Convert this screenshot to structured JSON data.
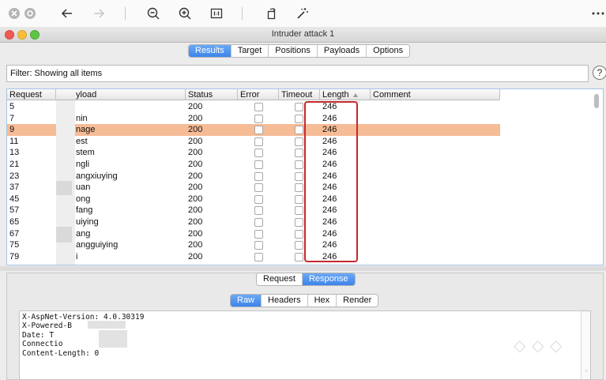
{
  "viewer": {
    "icons": [
      "close-circle-icon",
      "stop-circle-icon",
      "back-arrow-icon",
      "forward-arrow-icon",
      "zoom-out-icon",
      "zoom-in-icon",
      "actual-size-icon",
      "rotate-icon",
      "magic-wand-icon",
      "more-icon"
    ]
  },
  "window": {
    "title": "Intruder attack 1",
    "tabs": [
      {
        "label": "Results",
        "active": true
      },
      {
        "label": "Target",
        "active": false
      },
      {
        "label": "Positions",
        "active": false
      },
      {
        "label": "Payloads",
        "active": false
      },
      {
        "label": "Options",
        "active": false
      }
    ]
  },
  "filter": {
    "text": "Filter: Showing all items",
    "help": "?"
  },
  "table": {
    "columns": [
      "Request",
      "yload",
      "Status",
      "Error",
      "Timeout",
      "Length",
      "Comment"
    ],
    "rows": [
      {
        "request": "5",
        "payload": "",
        "status": "200",
        "length": "246",
        "selected": false
      },
      {
        "request": "7",
        "payload": "nin",
        "status": "200",
        "length": "246",
        "selected": false
      },
      {
        "request": "9",
        "payload": "nage",
        "status": "200",
        "length": "246",
        "selected": true
      },
      {
        "request": "11",
        "payload": "est",
        "status": "200",
        "length": "246",
        "selected": false
      },
      {
        "request": "13",
        "payload": "stem",
        "status": "200",
        "length": "246",
        "selected": false
      },
      {
        "request": "21",
        "payload": "ngli",
        "status": "200",
        "length": "246",
        "selected": false
      },
      {
        "request": "23",
        "payload": "angxiuying",
        "status": "200",
        "length": "246",
        "selected": false
      },
      {
        "request": "37",
        "payload": "uan",
        "status": "200",
        "length": "246",
        "selected": false
      },
      {
        "request": "45",
        "payload": "ong",
        "status": "200",
        "length": "246",
        "selected": false
      },
      {
        "request": "57",
        "payload": "fang",
        "status": "200",
        "length": "246",
        "selected": false
      },
      {
        "request": "65",
        "payload": "uiying",
        "status": "200",
        "length": "246",
        "selected": false
      },
      {
        "request": "67",
        "payload": "ang",
        "status": "200",
        "length": "246",
        "selected": false
      },
      {
        "request": "75",
        "payload": "angguiying",
        "status": "200",
        "length": "246",
        "selected": false
      },
      {
        "request": "79",
        "payload": "i",
        "status": "200",
        "length": "246",
        "selected": false
      }
    ]
  },
  "lower": {
    "tabs": [
      {
        "label": "Request",
        "active": false
      },
      {
        "label": "Response",
        "active": true
      }
    ],
    "view_tabs": [
      {
        "label": "Raw",
        "active": true
      },
      {
        "label": "Headers",
        "active": false
      },
      {
        "label": "Hex",
        "active": false
      },
      {
        "label": "Render",
        "active": false
      }
    ],
    "response_lines": [
      "X-AspNet-Version: 4.0.30319",
      "X-Powered-B    SP.NET",
      "Date: T",
      "Connectio",
      "Content-Length: 0"
    ]
  },
  "colors": {
    "accent": "#3d84ea",
    "selected_row": "#f6bc96",
    "highlight": "#c6282f"
  }
}
